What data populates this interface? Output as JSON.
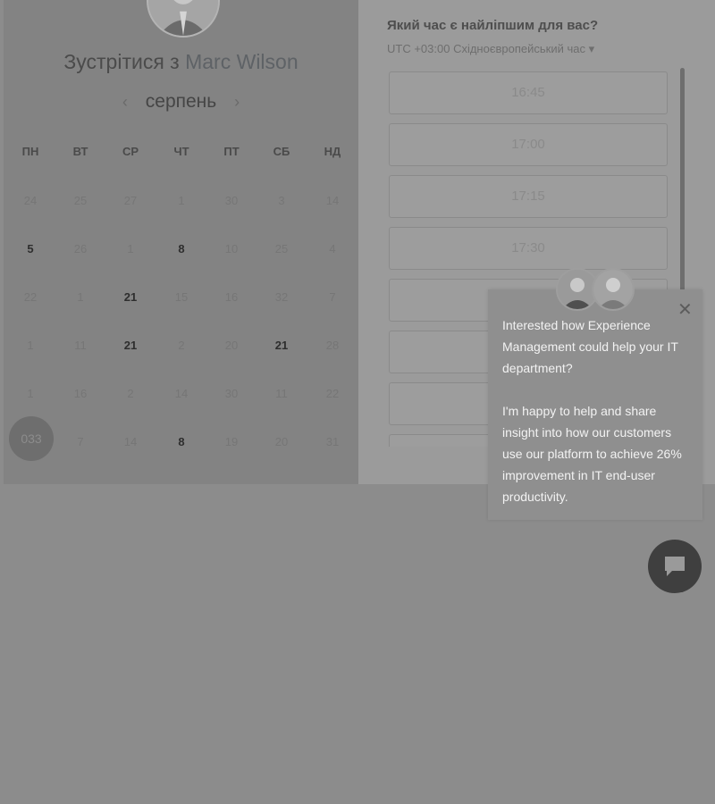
{
  "left": {
    "title_prefix": "Зустрітися з",
    "host_name": "Marc Wilson",
    "month": "серпень",
    "prev_icon": "chevron-left-icon",
    "next_icon": "chevron-right-icon",
    "weekdays": [
      "ПН",
      "ВТ",
      "СР",
      "ЧТ",
      "ПТ",
      "СБ",
      "НД"
    ],
    "weeks": [
      [
        "24",
        "25",
        "27",
        "1",
        "30",
        "3",
        "14"
      ],
      [
        "5",
        "26",
        "1",
        "8",
        "10",
        "25",
        "4"
      ],
      [
        "22",
        "1",
        "21",
        "15",
        "16",
        "32",
        "7"
      ],
      [
        "1",
        "11",
        "21",
        "2",
        "20",
        "21",
        "28"
      ],
      [
        "1",
        "16",
        "2",
        "14",
        "30",
        "11",
        "22"
      ],
      [
        "",
        "7",
        "14",
        "8",
        "19",
        "20",
        "31"
      ]
    ],
    "available_days": [
      "5",
      "8",
      "21"
    ],
    "today_bubble": "033"
  },
  "right": {
    "question": "Який час є найліпшим для вас?",
    "timezone": "UTC +03:00 Східноєвропейський час",
    "timezone_icon": "caret-down-icon",
    "slots": [
      "16:45",
      "17:00",
      "17:15",
      "17:30",
      "",
      "",
      "",
      ""
    ]
  },
  "chat": {
    "close_icon": "close-icon",
    "message_1": "Interested how Experience Management could help your IT department?",
    "message_2": "I'm happy to help and share insight into how our customers use our platform to achieve 26% improvement in IT end-user productivity.",
    "launcher_icon": "chat-bubble-icon"
  },
  "colors": {
    "overlay": "#8c8c8c",
    "left_panel": "#838383",
    "right_panel": "#9b9b9b",
    "chat_launcher": "#3f3f3f"
  }
}
